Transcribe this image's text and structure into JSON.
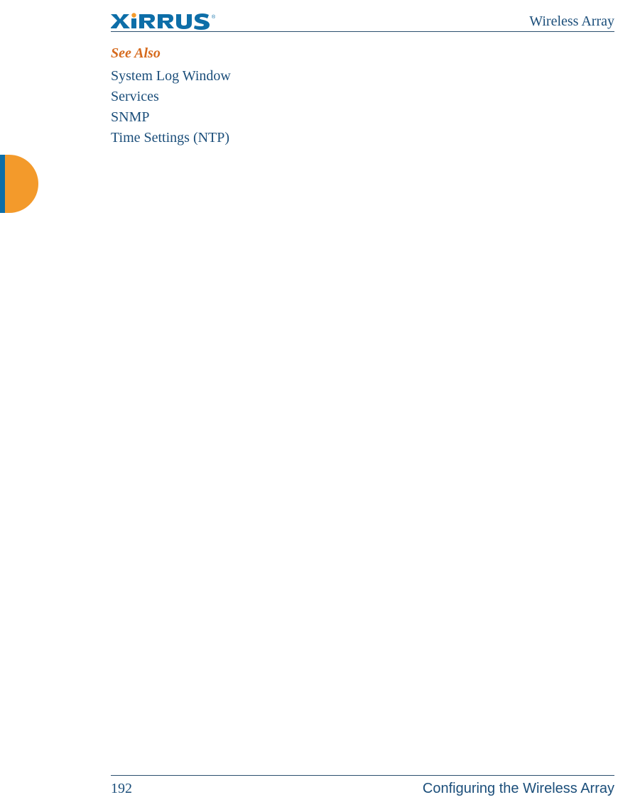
{
  "header": {
    "doc_title": "Wireless Array",
    "logo_text": "XIRRUS"
  },
  "content": {
    "see_also_heading": "See Also",
    "see_also_items": [
      "System Log Window",
      "Services",
      "SNMP",
      "Time Settings (NTP)"
    ]
  },
  "footer": {
    "page_number": "192",
    "section_title": "Configuring the Wireless Array"
  }
}
